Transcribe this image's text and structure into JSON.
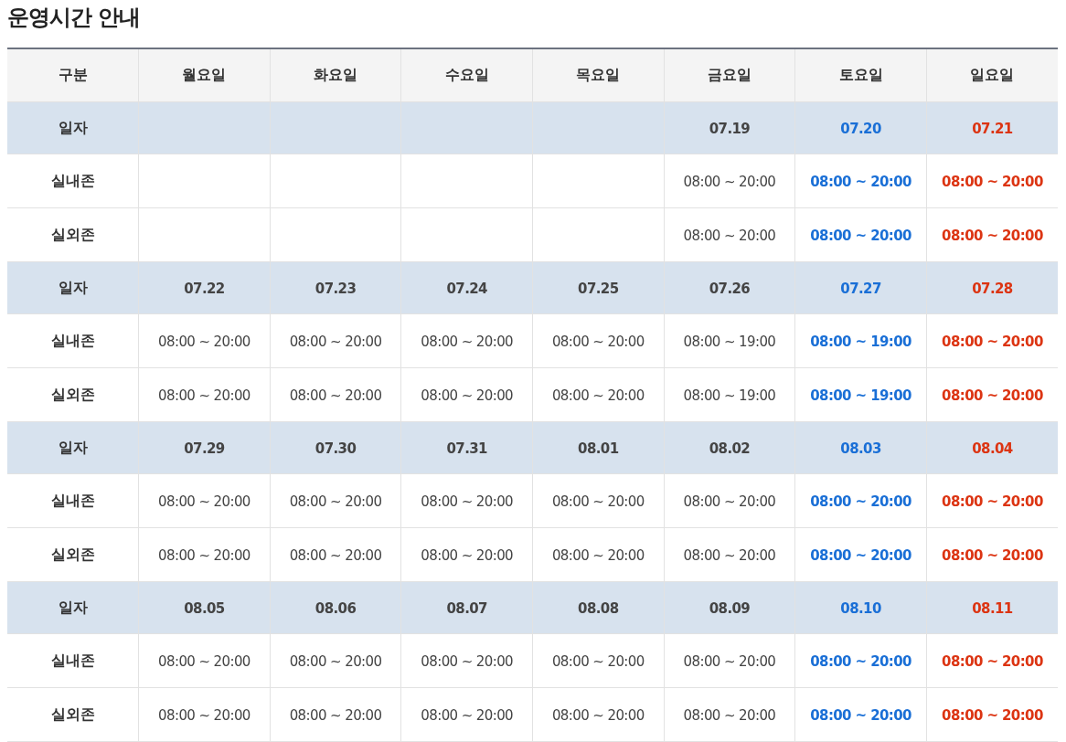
{
  "title": "운영시간 안내",
  "table": {
    "columns": [
      {
        "label": "구분",
        "kind": "label"
      },
      {
        "label": "월요일",
        "kind": "weekday"
      },
      {
        "label": "화요일",
        "kind": "weekday"
      },
      {
        "label": "수요일",
        "kind": "weekday"
      },
      {
        "label": "목요일",
        "kind": "weekday"
      },
      {
        "label": "금요일",
        "kind": "weekday"
      },
      {
        "label": "토요일",
        "kind": "saturday"
      },
      {
        "label": "일요일",
        "kind": "sunday"
      }
    ],
    "rows": [
      {
        "kind": "date",
        "cells": [
          "일자",
          "",
          "",
          "",
          "",
          "07.19",
          "07.20",
          "07.21"
        ]
      },
      {
        "kind": "time",
        "cells": [
          "실내존",
          "",
          "",
          "",
          "",
          "08:00 ~ 20:00",
          "08:00 ~ 20:00",
          "08:00 ~ 20:00"
        ]
      },
      {
        "kind": "time",
        "cells": [
          "실외존",
          "",
          "",
          "",
          "",
          "08:00 ~ 20:00",
          "08:00 ~ 20:00",
          "08:00 ~ 20:00"
        ]
      },
      {
        "kind": "date",
        "cells": [
          "일자",
          "07.22",
          "07.23",
          "07.24",
          "07.25",
          "07.26",
          "07.27",
          "07.28"
        ]
      },
      {
        "kind": "time",
        "cells": [
          "실내존",
          "08:00 ~ 20:00",
          "08:00 ~ 20:00",
          "08:00 ~ 20:00",
          "08:00 ~ 20:00",
          "08:00 ~ 19:00",
          "08:00 ~ 19:00",
          "08:00 ~ 20:00"
        ]
      },
      {
        "kind": "time",
        "cells": [
          "실외존",
          "08:00 ~ 20:00",
          "08:00 ~ 20:00",
          "08:00 ~ 20:00",
          "08:00 ~ 20:00",
          "08:00 ~ 19:00",
          "08:00 ~ 19:00",
          "08:00 ~ 20:00"
        ]
      },
      {
        "kind": "date",
        "cells": [
          "일자",
          "07.29",
          "07.30",
          "07.31",
          "08.01",
          "08.02",
          "08.03",
          "08.04"
        ]
      },
      {
        "kind": "time",
        "cells": [
          "실내존",
          "08:00 ~ 20:00",
          "08:00 ~ 20:00",
          "08:00 ~ 20:00",
          "08:00 ~ 20:00",
          "08:00 ~ 20:00",
          "08:00 ~ 20:00",
          "08:00 ~ 20:00"
        ]
      },
      {
        "kind": "time",
        "cells": [
          "실외존",
          "08:00 ~ 20:00",
          "08:00 ~ 20:00",
          "08:00 ~ 20:00",
          "08:00 ~ 20:00",
          "08:00 ~ 20:00",
          "08:00 ~ 20:00",
          "08:00 ~ 20:00"
        ]
      },
      {
        "kind": "date",
        "cells": [
          "일자",
          "08.05",
          "08.06",
          "08.07",
          "08.08",
          "08.09",
          "08.10",
          "08.11"
        ]
      },
      {
        "kind": "time",
        "cells": [
          "실내존",
          "08:00 ~ 20:00",
          "08:00 ~ 20:00",
          "08:00 ~ 20:00",
          "08:00 ~ 20:00",
          "08:00 ~ 20:00",
          "08:00 ~ 20:00",
          "08:00 ~ 20:00"
        ]
      },
      {
        "kind": "time",
        "cells": [
          "실외존",
          "08:00 ~ 20:00",
          "08:00 ~ 20:00",
          "08:00 ~ 20:00",
          "08:00 ~ 20:00",
          "08:00 ~ 20:00",
          "08:00 ~ 20:00",
          "08:00 ~ 20:00"
        ]
      }
    ]
  }
}
